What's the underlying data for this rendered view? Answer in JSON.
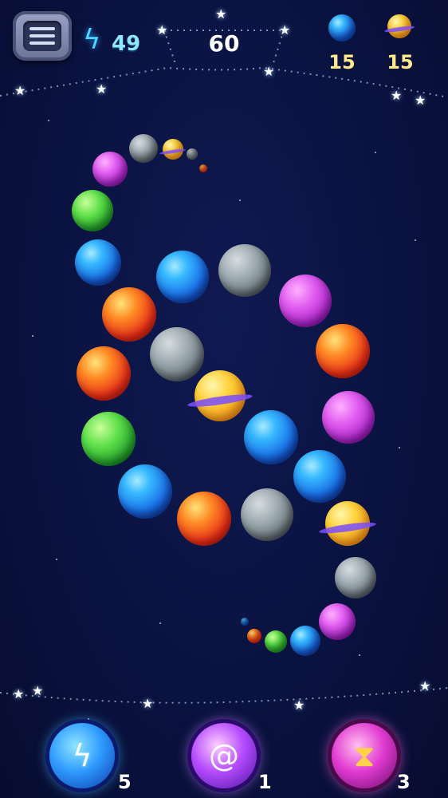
{
  "hud": {
    "energy": "49",
    "moves": "60",
    "targets": [
      {
        "icon": "blue-planet-icon",
        "count": "15",
        "color": "#2f8cff"
      },
      {
        "icon": "ringed-planet-icon",
        "count": "15",
        "color": "#ffcf3a"
      }
    ]
  },
  "boosters": [
    {
      "icon": "lightning-icon",
      "count": "5",
      "color": "#2f9bff"
    },
    {
      "icon": "swirl-icon",
      "count": "1",
      "color": "#b64cff"
    },
    {
      "icon": "hourglass-icon",
      "count": "3",
      "color": "#e13bd1"
    }
  ],
  "planet_chain": [
    "grey",
    "yellow",
    "purple",
    "green",
    "blue",
    "blue",
    "grey",
    "purple",
    "red",
    "grey",
    "red",
    "red",
    "yellow",
    "purple",
    "green",
    "blue",
    "blue",
    "blue",
    "blue",
    "red",
    "grey",
    "yellow",
    "grey",
    "purple",
    "blue",
    "green",
    "red"
  ],
  "colors": {
    "background": "#0a1240",
    "accent": "#8fe6ff",
    "target_text": "#ffe98a"
  }
}
